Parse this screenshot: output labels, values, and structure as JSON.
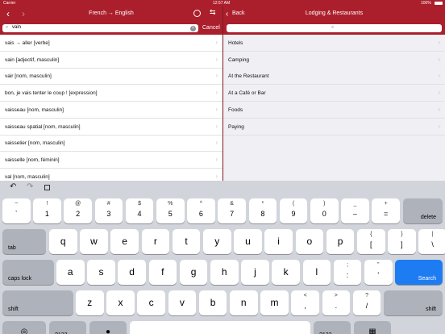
{
  "status": {
    "carrier": "Carrier",
    "time": "12:57 AM",
    "battery": "100%"
  },
  "left_nav": {
    "title": "French → English"
  },
  "search": {
    "value": "vain",
    "cancel": "Cancel"
  },
  "results": [
    "vais → aller [verbe]",
    "vain [adjectif, masculin]",
    "vair [nom, masculin]",
    "bon, je vais tenter le coup ! [expression]",
    "vaisseau [nom, masculin]",
    "vaisseau spatial [nom, masculin]",
    "vaisselier [nom, masculin]",
    "vaisselle [nom, féminin]",
    "val [nom, masculin]"
  ],
  "right_nav": {
    "back": "Back",
    "title": "Lodging & Restaurants"
  },
  "categories": [
    "Hotels",
    "Camping",
    "At the Restaurant",
    "At a Café or Bar",
    "Foods",
    "Paying"
  ],
  "keyboard": {
    "num_row": [
      [
        "~",
        "`"
      ],
      [
        "!",
        "1"
      ],
      [
        "@",
        "2"
      ],
      [
        "#",
        "3"
      ],
      [
        "$",
        "4"
      ],
      [
        "%",
        "5"
      ],
      [
        "^",
        "6"
      ],
      [
        "&",
        "7"
      ],
      [
        "*",
        "8"
      ],
      [
        "(",
        "9"
      ],
      [
        ")",
        "0"
      ],
      [
        "_",
        "–"
      ],
      [
        "+",
        "="
      ]
    ],
    "delete": "delete",
    "tab": "tab",
    "row1": [
      "q",
      "w",
      "e",
      "r",
      "t",
      "y",
      "u",
      "i",
      "o",
      "p"
    ],
    "row1_extra": [
      [
        "{",
        "["
      ],
      [
        "}",
        "]"
      ],
      [
        "|",
        "\\"
      ]
    ],
    "caps": "caps lock",
    "row2": [
      "a",
      "s",
      "d",
      "f",
      "g",
      "h",
      "j",
      "k",
      "l"
    ],
    "row2_extra": [
      [
        ";",
        ":"
      ],
      [
        "”",
        "’"
      ]
    ],
    "search": "Search",
    "shift": "shift",
    "row3": [
      "z",
      "x",
      "c",
      "v",
      "b",
      "n",
      "m"
    ],
    "row3_extra": [
      [
        "<",
        ","
      ],
      [
        ">",
        "."
      ],
      [
        "?",
        "/"
      ]
    ],
    "numkey": ".?123",
    "colors": {
      "accent": "#ab1f2c",
      "blue": "#1e7cf2"
    }
  }
}
